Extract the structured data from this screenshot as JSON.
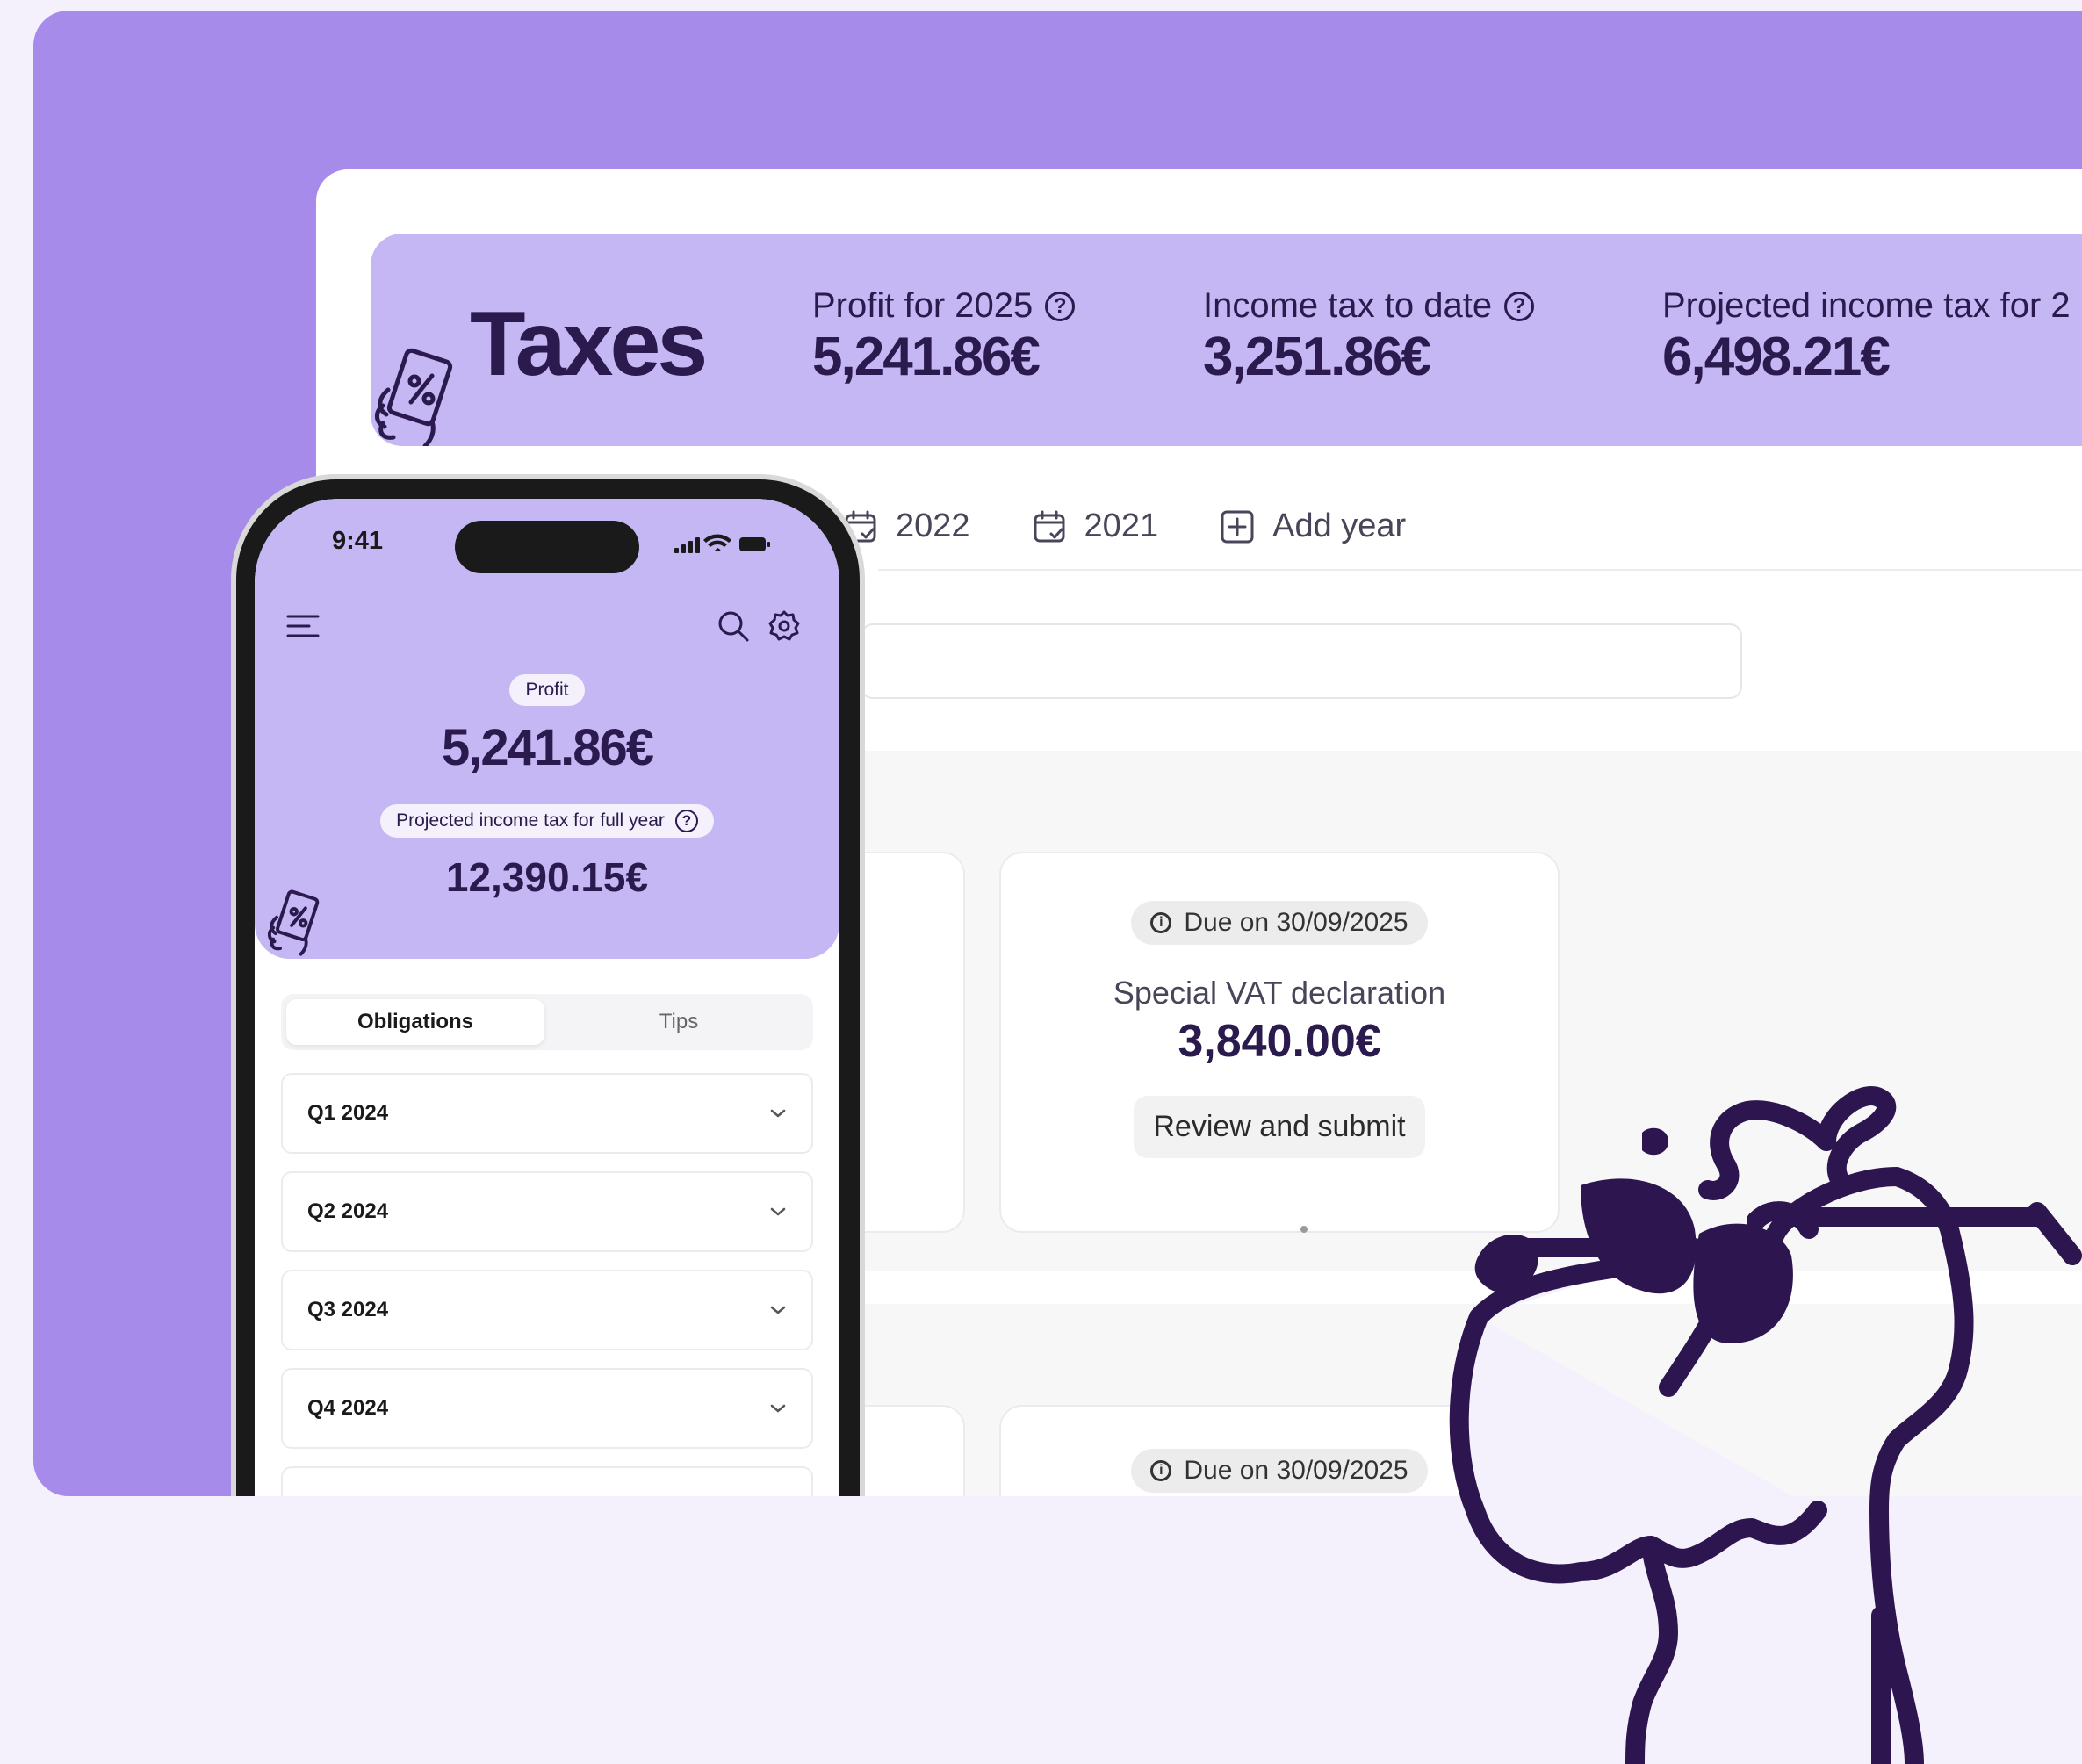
{
  "desktop": {
    "title": "Taxes",
    "stats": [
      {
        "label": "Profit for 2025",
        "value": "5,241.86€"
      },
      {
        "label": "Income tax to date",
        "value": "3,251.86€"
      },
      {
        "label": "Projected income tax for 2",
        "value": "6,498.21€"
      }
    ],
    "year_tabs": [
      {
        "label": "2022"
      },
      {
        "label": "2021"
      }
    ],
    "add_year_label": "Add year",
    "cards": [
      {
        "due": "Due on 30/09/2025",
        "title": "Special VAT declaration",
        "amount": "3,840.00€",
        "button": "Review and submit"
      },
      {
        "due": "Due on 30/09/2025"
      }
    ]
  },
  "phone": {
    "time": "9:41",
    "profit_pill": "Profit",
    "profit_value": "5,241.86€",
    "projected_label": "Projected income tax for full year",
    "projected_value": "12,390.15€",
    "tabs": {
      "active": "Obligations",
      "inactive": "Tips"
    },
    "quarters": [
      "Q1 2024",
      "Q2 2024",
      "Q3 2024",
      "Q4 2024"
    ]
  },
  "colors": {
    "brand_purple": "#a68bea",
    "light_purple": "#c5b6f4",
    "dark_ink": "#2b1a4d",
    "page_bg": "#f4f0fc"
  }
}
